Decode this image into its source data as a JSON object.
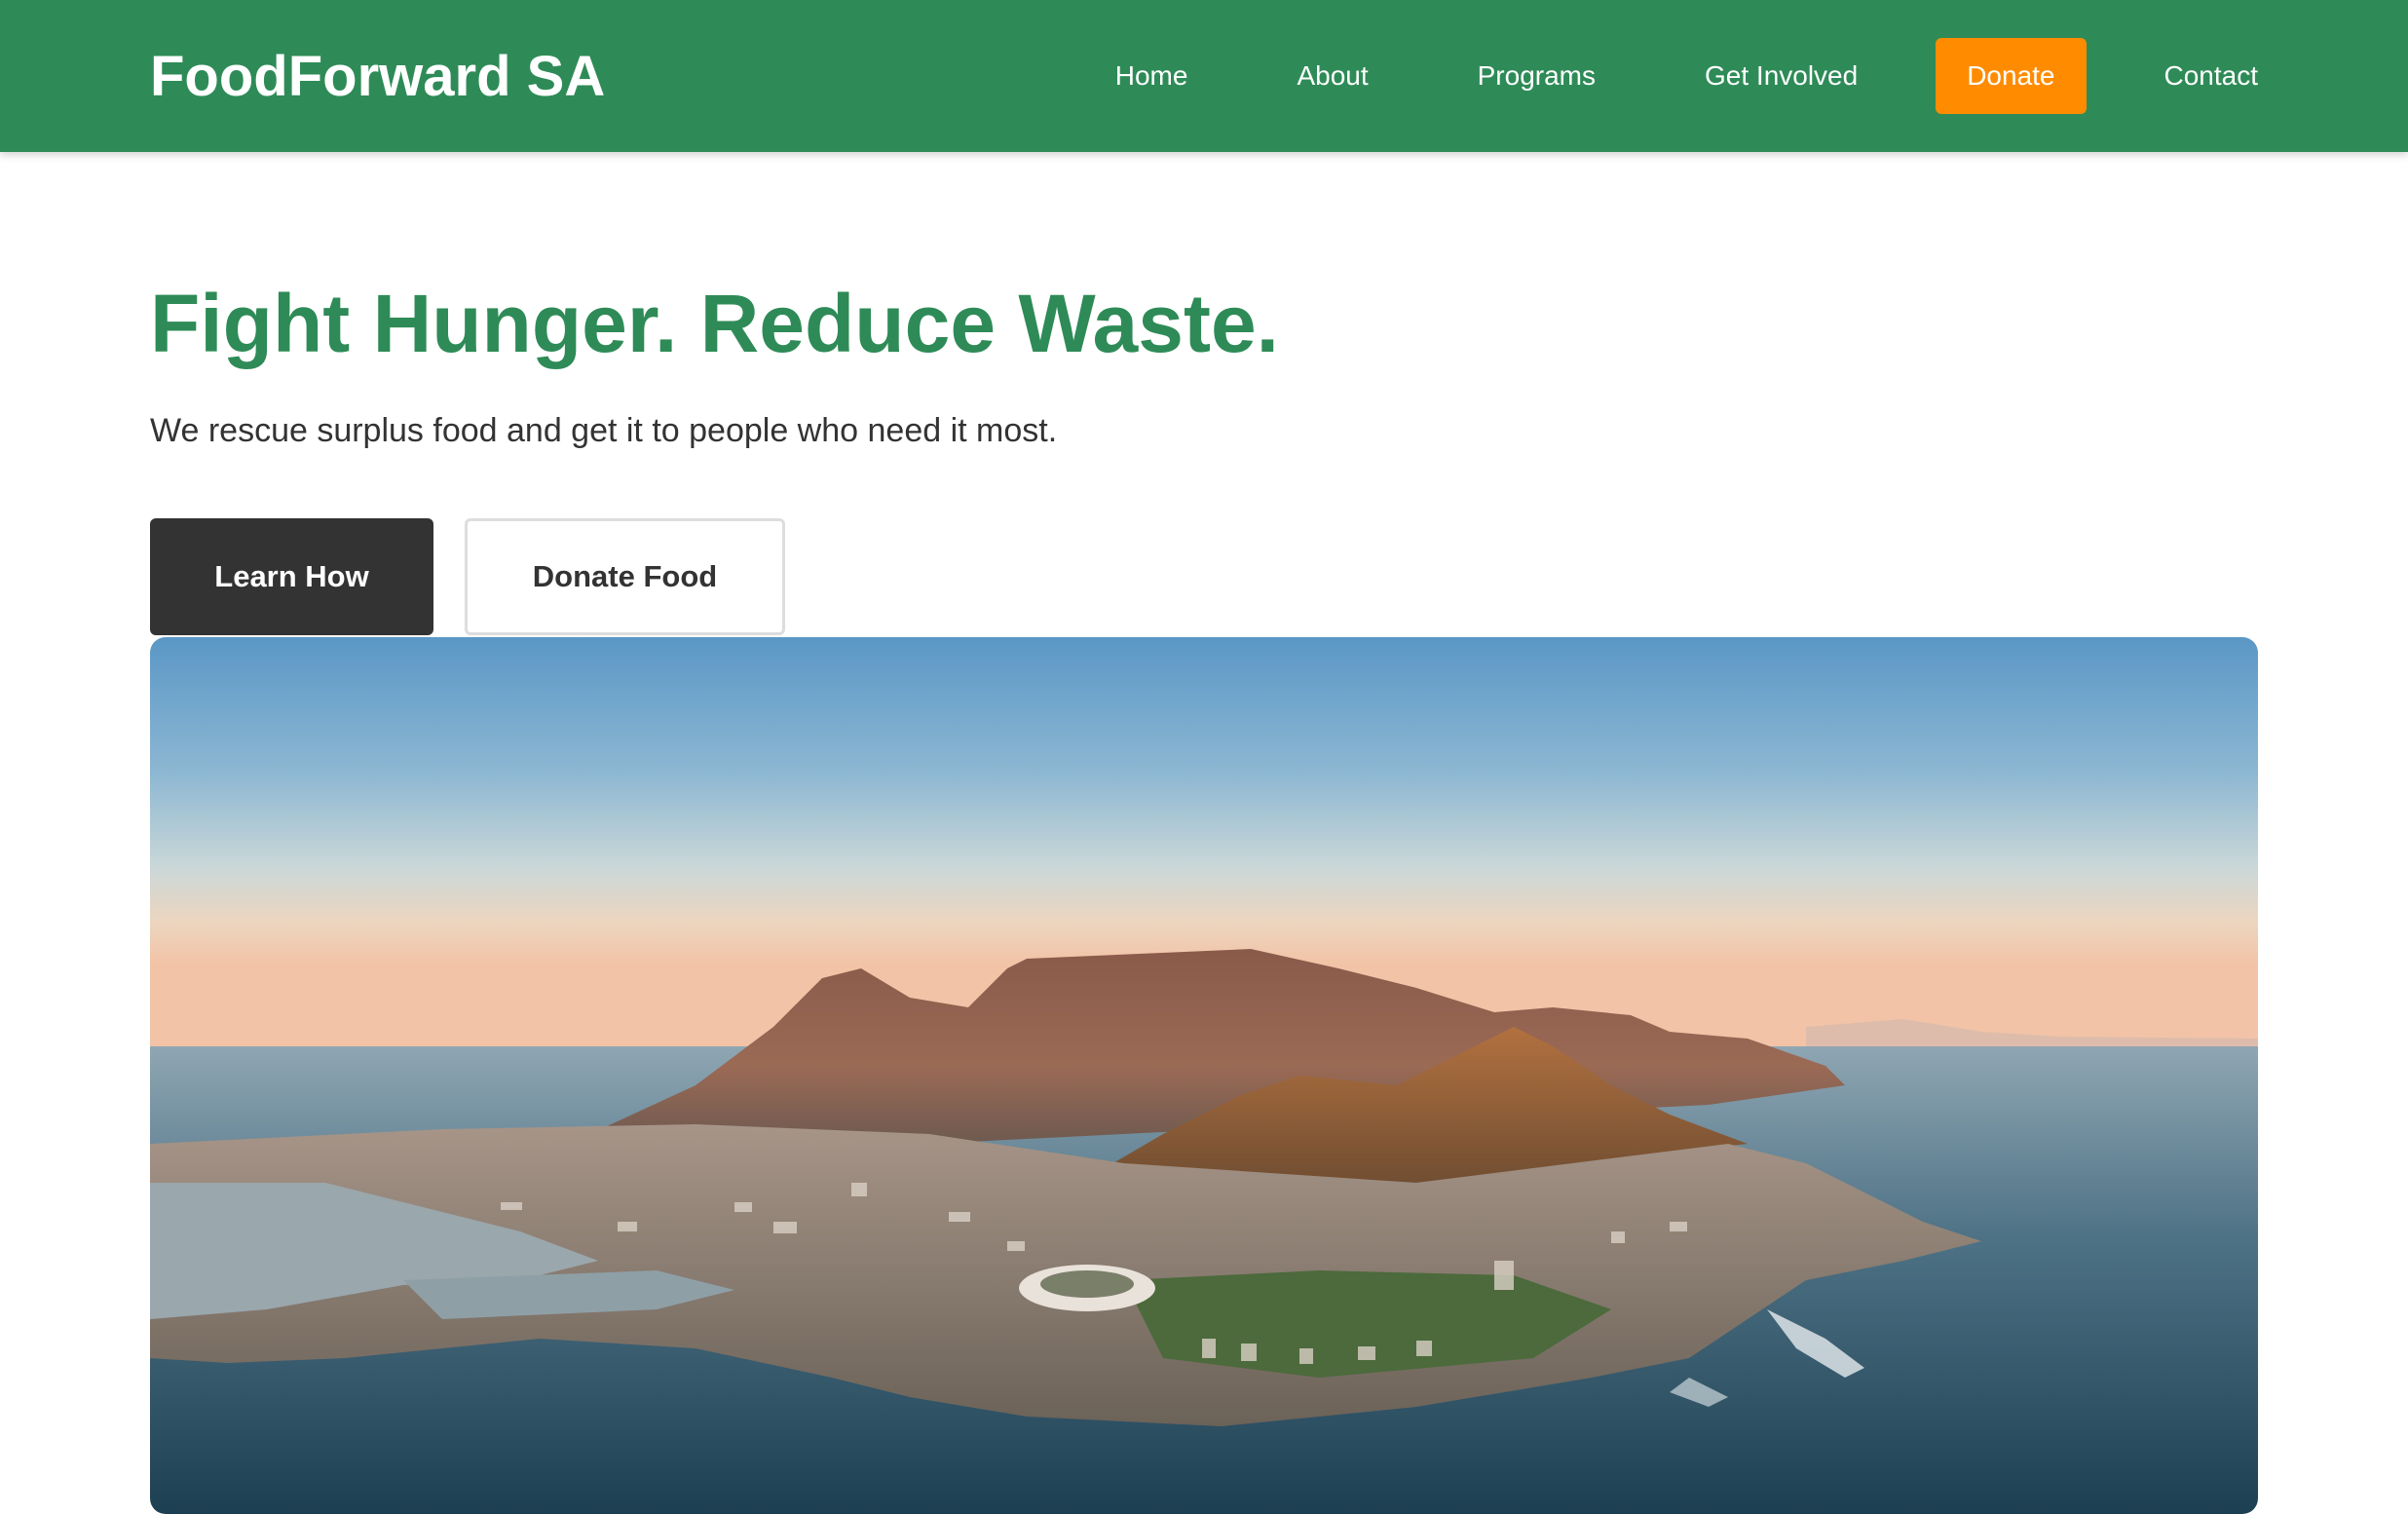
{
  "header": {
    "brand": "FoodForward SA",
    "nav": {
      "home": "Home",
      "about": "About",
      "programs": "Programs",
      "get_involved": "Get Involved",
      "donate": "Donate",
      "contact": "Contact"
    }
  },
  "hero": {
    "title": "Fight Hunger. Reduce Waste.",
    "subtitle": "We rescue surplus food and get it to people who need it most.",
    "primary_button": "Learn How",
    "secondary_button": "Donate Food",
    "image_subject": "aerial photo of a coastal city with a flat-topped mountain"
  },
  "colors": {
    "brand_green": "#2e8b57",
    "donate_orange": "#ff8c00",
    "dark_button": "#333333",
    "text": "#333333"
  }
}
